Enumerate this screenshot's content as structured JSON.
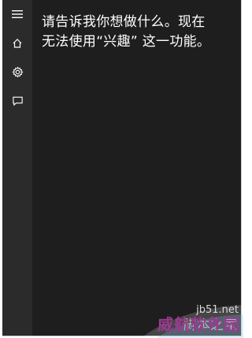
{
  "sidebar": {
    "items": [
      {
        "icon": "hamburger-menu-icon"
      },
      {
        "icon": "home-icon"
      },
      {
        "icon": "gear-icon"
      },
      {
        "icon": "feedback-icon"
      }
    ]
  },
  "main": {
    "message_lines": [
      "请告诉我你想做什么。现在",
      "无法使用“兴趣” 这一功能。"
    ]
  },
  "watermark": {
    "site": "jb51.net",
    "name": "威航软件园",
    "sub": "脚本之家"
  },
  "colors": {
    "panel_bg": "#1e1e1e",
    "sidebar_bg": "#2b2b2b",
    "text": "#ffffff",
    "watermark_accent": "#9b3a8f"
  }
}
